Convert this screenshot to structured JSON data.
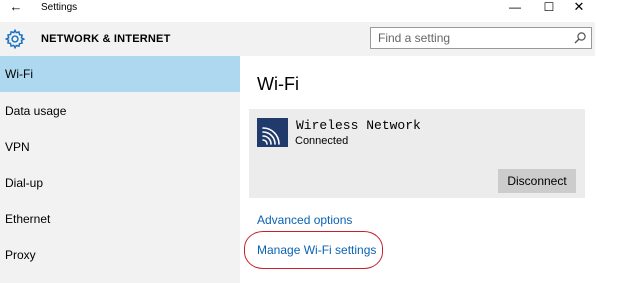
{
  "window": {
    "back_icon": "back-arrow-icon",
    "title": "Settings",
    "minimize_glyph": "—",
    "maximize_glyph": "☐",
    "close_glyph": "✕"
  },
  "header": {
    "icon": "gear-icon",
    "title": "NETWORK & INTERNET",
    "search": {
      "placeholder": "Find a setting",
      "value": ""
    }
  },
  "sidebar": {
    "items": [
      {
        "label": "Wi-Fi",
        "selected": true
      },
      {
        "label": "Data usage",
        "selected": false
      },
      {
        "label": "VPN",
        "selected": false
      },
      {
        "label": "Dial-up",
        "selected": false
      },
      {
        "label": "Ethernet",
        "selected": false
      },
      {
        "label": "Proxy",
        "selected": false
      }
    ]
  },
  "main": {
    "title": "Wi-Fi",
    "network": {
      "icon": "wifi-signal-icon",
      "name": "Wireless Network",
      "status": "Connected",
      "disconnect_label": "Disconnect"
    },
    "links": {
      "advanced": "Advanced options",
      "manage": "Manage Wi-Fi settings"
    }
  },
  "colors": {
    "selected_nav": "#add8f0",
    "nav_bg": "#f2f2f2",
    "link": "#0a62b4",
    "tile": "#1f3a6b",
    "highlight": "#c8202a"
  }
}
